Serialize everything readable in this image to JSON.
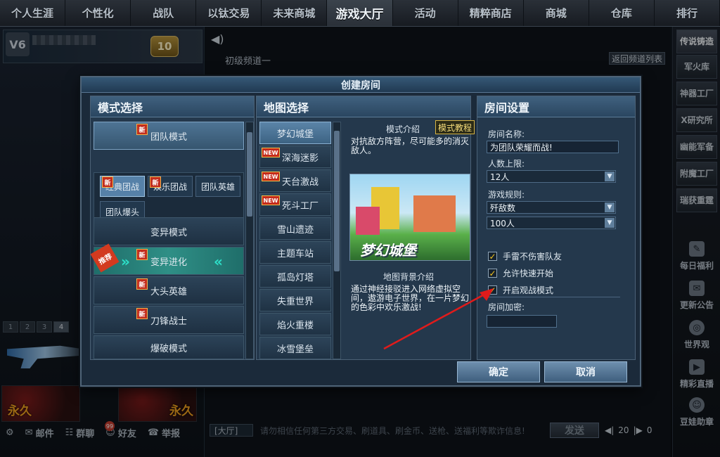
{
  "topnav": [
    "个人生涯",
    "个性化",
    "战队",
    "以钛交易",
    "未来商城",
    "游戏大厅",
    "活动",
    "精粹商店",
    "商城",
    "仓库",
    "排行"
  ],
  "profile": {
    "rank_text": "10",
    "badge_text": "V6"
  },
  "weapon_tabs": [
    "1",
    "2",
    "3",
    "4"
  ],
  "permanent_label": "永久",
  "bottom_bar": {
    "mail": "邮件",
    "group": "群聊",
    "friends": "好友",
    "report": "举报",
    "group_badge": "99"
  },
  "lobby": {
    "channel": "初级频道一",
    "back_button": "返回频道列表"
  },
  "chat": {
    "tag": "[大厅]",
    "placeholder": "请勿相信任何第三方交易、刷道具、刷金币、送枪、送福利等欺诈信息!",
    "send": "发送",
    "volume": "20",
    "count": "0"
  },
  "right_sidebar": {
    "buttons": [
      "传说铸造",
      "军火库",
      "神器工厂",
      "X研究所",
      "幽能军备",
      "附魔工厂",
      "瑞获重霆"
    ],
    "items": [
      {
        "label": "每日福利",
        "icon": "gift-icon"
      },
      {
        "label": "更新公告",
        "icon": "notice-icon"
      },
      {
        "label": "世界观",
        "icon": "globe-icon"
      },
      {
        "label": "精彩直播",
        "icon": "camera-icon"
      },
      {
        "label": "豆娃助章",
        "icon": "mascot-icon"
      }
    ]
  },
  "dialog": {
    "title": "创建房间",
    "mode_panel": {
      "header": "模式选择",
      "team_mode": "团队模式",
      "sub_modes": [
        "经典团战",
        "娱乐团战",
        "团队英雄",
        "团队爆头"
      ],
      "modes": [
        "变异模式",
        "变异进化",
        "大头英雄",
        "刀锋战士",
        "爆破模式"
      ],
      "recommend_tag": "推荐",
      "new_tag": "新"
    },
    "map_panel": {
      "header": "地图选择",
      "maps": [
        "梦幻城堡",
        "深海迷影",
        "天台激战",
        "死斗工厂",
        "雪山遗迹",
        "主题车站",
        "孤岛灯塔",
        "失重世界",
        "焰火重楼",
        "冰雪堡垒"
      ],
      "new_tag": "NEW",
      "tab_intro": "模式介绍",
      "tab_tutorial": "模式教程",
      "mode_desc": "对抗敌方阵营，尽可能多的消灭敌人。",
      "map_image_title": "梦幻城堡",
      "bg_title": "地图背景介绍",
      "bg_desc": "通过神经接驳进入网络虚拟空间，遨游电子世界，在一片梦幻的色彩中欢乐激战!"
    },
    "room_panel": {
      "header": "房间设置",
      "name_label": "房间名称:",
      "name_value": "为团队荣耀而战!",
      "limit_label": "人数上限:",
      "limit_value": "12人",
      "rule_label": "游戏规则:",
      "rule_value": "歼敌数",
      "rule_count": "100人",
      "options": [
        "手雷不伤害队友",
        "允许快速开始",
        "开启观战模式"
      ],
      "password_label": "房间加密:",
      "password_value": ""
    },
    "confirm": "确定",
    "cancel": "取消"
  }
}
